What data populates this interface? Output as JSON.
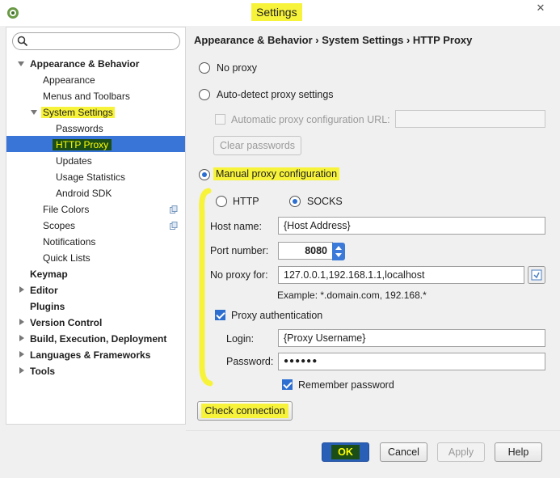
{
  "window": {
    "title": "Settings",
    "close_glyph": "✕"
  },
  "search": {
    "placeholder": "",
    "icon": "search-icon"
  },
  "tree": {
    "appearance_behavior": "Appearance & Behavior",
    "appearance": "Appearance",
    "menus_toolbars": "Menus and Toolbars",
    "system_settings": "System Settings",
    "passwords": "Passwords",
    "http_proxy": "HTTP Proxy",
    "updates": "Updates",
    "usage_statistics": "Usage Statistics",
    "android_sdk": "Android SDK",
    "file_colors": "File Colors",
    "scopes": "Scopes",
    "notifications": "Notifications",
    "quick_lists": "Quick Lists",
    "keymap": "Keymap",
    "editor": "Editor",
    "plugins": "Plugins",
    "version_control": "Version Control",
    "build": "Build, Execution, Deployment",
    "languages": "Languages & Frameworks",
    "tools": "Tools"
  },
  "breadcrumb": "Appearance & Behavior  ›  System Settings  ›  HTTP Proxy",
  "proxy": {
    "no_proxy": "No proxy",
    "auto_detect": "Auto-detect proxy settings",
    "auto_config_url": "Automatic proxy configuration URL:",
    "clear_passwords": "Clear passwords",
    "manual": "Manual proxy configuration",
    "http": "HTTP",
    "socks": "SOCKS",
    "host_label": "Host name:",
    "host_value": "{Host Address}",
    "port_label": "Port number:",
    "port_value": "8080",
    "no_proxy_for_label": "No proxy for:",
    "no_proxy_for_value": "127.0.0.1,192.168.1.1,localhost",
    "example": "Example: *.domain.com, 192.168.*",
    "proxy_auth": "Proxy authentication",
    "login_label": "Login:",
    "login_value": "{Proxy Username}",
    "password_label": "Password:",
    "password_value": "●●●●●●",
    "remember": "Remember password",
    "check_connection": "Check connection"
  },
  "footer": {
    "ok": "OK",
    "cancel": "Cancel",
    "apply": "Apply",
    "help": "Help"
  },
  "colors": {
    "highlight": "#f7f33a",
    "selection": "#3875d7",
    "accent": "#2c6fd1"
  }
}
